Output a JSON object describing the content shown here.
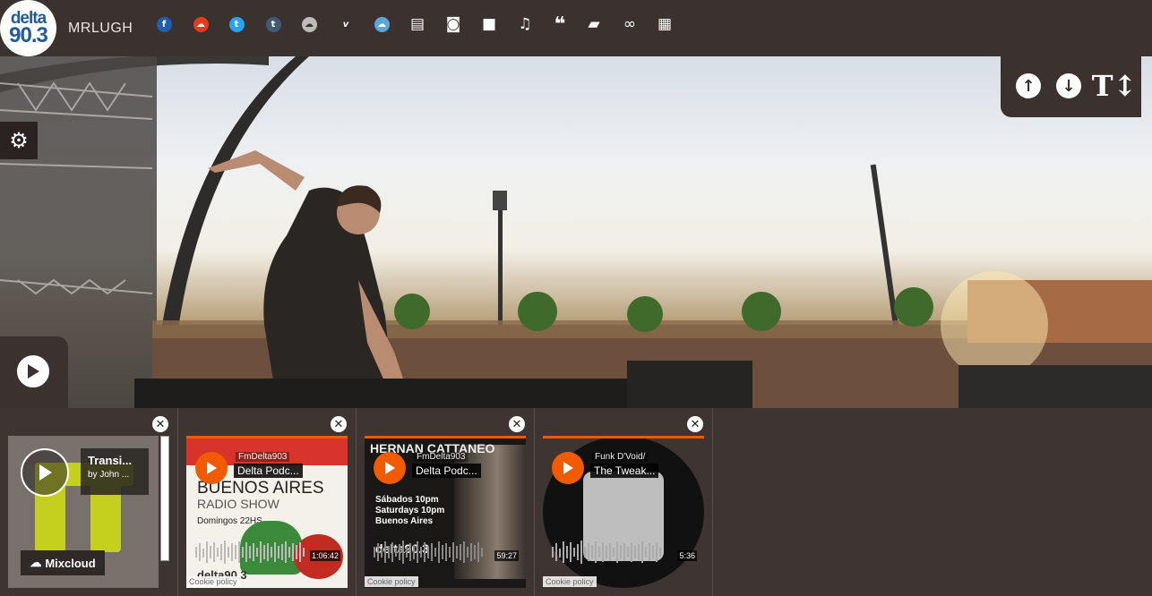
{
  "header": {
    "logo_line1": "delta",
    "logo_line2": "90.3",
    "username": "MRLUGH",
    "social_icons": [
      "facebook-icon",
      "soundcloud-icon",
      "twitter-icon",
      "tumblr-icon",
      "mixcloud-icon",
      "vimeo-icon",
      "cloud-sync-icon",
      "document-icon",
      "camera-icon",
      "video-icon",
      "music-icon",
      "quote-icon",
      "book-icon",
      "link-icon",
      "calendar-icon"
    ]
  },
  "colors": {
    "bar": "#3b3230",
    "soundcloud_orange": "#f05a00",
    "facebook": "#1f5fae",
    "twitter": "#2aa3ef"
  },
  "mixcloud_widget": {
    "title": "Transi...",
    "by": "by John ...",
    "brand": "Mixcloud"
  },
  "soundcloud_widgets": [
    {
      "user": "FmDelta903",
      "track": "Delta Podc...",
      "duration": "1:06:42",
      "cookie": "Cookie policy",
      "art_lines": [
        "BUENOS AIRES",
        "RADIO SHOW",
        "Domingos 22HS"
      ],
      "art_logo": "delta90.3"
    },
    {
      "user": "FmDelta903",
      "track": "Delta Podc...",
      "duration": "59:27",
      "cookie": "Cookie policy",
      "art_lines": [
        "HERNAN CATTANEO",
        "Sábados 10pm",
        "Saturdays 10pm",
        "Buenos Aires"
      ],
      "art_logo": "delta90.3"
    },
    {
      "user": "Funk D'Void/",
      "track": "The Tweak...",
      "duration": "5:36",
      "cookie": "Cookie policy"
    }
  ]
}
